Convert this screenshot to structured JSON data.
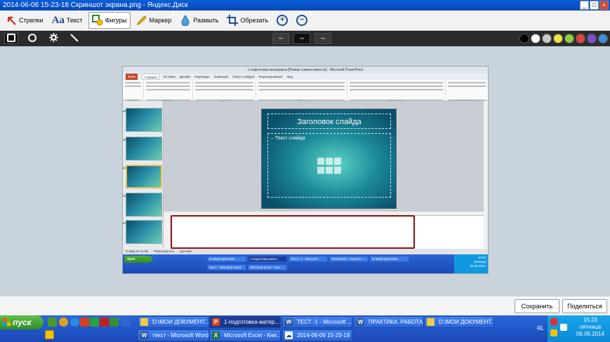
{
  "window": {
    "title": "2014-06-06 15-23-18 Скриншот экрана.png - Яндекс.Диск",
    "controls": [
      "_",
      "□",
      "×"
    ]
  },
  "toolbar": {
    "tools": [
      {
        "id": "arrows",
        "label": "Стрелки",
        "icon": "arrow-icon",
        "active": false
      },
      {
        "id": "text",
        "label": "Текст",
        "icon_text": "Aa",
        "icon": "text-icon",
        "active": false
      },
      {
        "id": "shapes",
        "label": "Фигуры",
        "icon": "shapes-icon",
        "active": true
      },
      {
        "id": "marker",
        "label": "Маркер",
        "icon": "marker-icon",
        "active": false
      },
      {
        "id": "blur",
        "label": "Размыть",
        "icon": "drop-icon",
        "active": false
      },
      {
        "id": "crop",
        "label": "Обрезать",
        "icon": "crop-icon",
        "active": false
      }
    ],
    "zoom_in": "+",
    "zoom_out": "−"
  },
  "subbar": {
    "shapes": [
      "square-icon",
      "circle-icon",
      "gear-icon",
      "line-icon"
    ],
    "selected_shape": "square-icon",
    "strokes": [
      "~",
      "~",
      "~"
    ],
    "colors": [
      "#000000",
      "#ffffff",
      "#c8c8c8",
      "#f2e24a",
      "#8fcf3c",
      "#e24040",
      "#7a4fd0",
      "#3c8ee0",
      "#9a9a9a"
    ]
  },
  "screenshot": {
    "ppt_title": "1-подготовка материала [Режим совместимости] - Microsoft PowerPoint",
    "ppt_tabs": [
      "Файл",
      "Главная",
      "Вставка",
      "Дизайн",
      "Переходы",
      "Анимация",
      "Показ слайдов",
      "Рецензирование",
      "Вид"
    ],
    "ribbon_groups": [
      "Буфер обм...",
      "Слайды",
      "Шрифт",
      "Абзац",
      "Рисование",
      "Редактирование"
    ],
    "slide_numbers": [
      "49",
      "50",
      "51",
      "52",
      "53"
    ],
    "slide_title": "Заголовок слайда",
    "slide_body": "– Текст слайда",
    "status": [
      "Слайд 51 из 66",
      "Переходность",
      "русский"
    ],
    "inner_start": "пуск",
    "inner_tasks": [
      "D:\\МОИ ДОКУМЕ...",
      "1-подготовка мате...",
      "ТЕСТ -1 - Microsof...",
      "ПРАКТИКА. РАБОТА ...",
      "D:\\МОИ ДОКУМЕ...",
      "текст - Microsoft Word",
      "Microsoft Excel - Кни..."
    ],
    "inner_tray": [
      "15:23",
      "пятница",
      "06.06.2014"
    ]
  },
  "actions": {
    "save": "Сохранить",
    "share": "Поделиться"
  },
  "taskbar": {
    "start": "пуск",
    "tasks_row1": [
      {
        "label": "D:\\МОИ ДОКУМЕНТ...",
        "icon": "folder-icon",
        "active": false
      },
      {
        "label": "1-подготовка матер...",
        "icon": "powerpoint-icon",
        "active": true
      },
      {
        "label": "ТЕСТ -1 - Microsoft ...",
        "icon": "word-icon",
        "active": false
      },
      {
        "label": "ПРАКТИКА. РАБОТА ...",
        "icon": "word-icon",
        "active": false
      },
      {
        "label": "D:\\МОИ ДОКУМЕНТ...",
        "icon": "folder-icon",
        "active": false
      }
    ],
    "tasks_row2": [
      {
        "label": "текст - Microsoft Word",
        "icon": "word-icon",
        "active": false
      },
      {
        "label": "Microsoft Excel - Кни...",
        "icon": "excel-icon",
        "active": false
      },
      {
        "label": "2014-06-06 15-23-18 ...",
        "icon": "yandex-disk-icon",
        "active": false
      }
    ],
    "lang": "RL",
    "time": "15:23",
    "day": "пятница",
    "date": "06.06.2014"
  }
}
